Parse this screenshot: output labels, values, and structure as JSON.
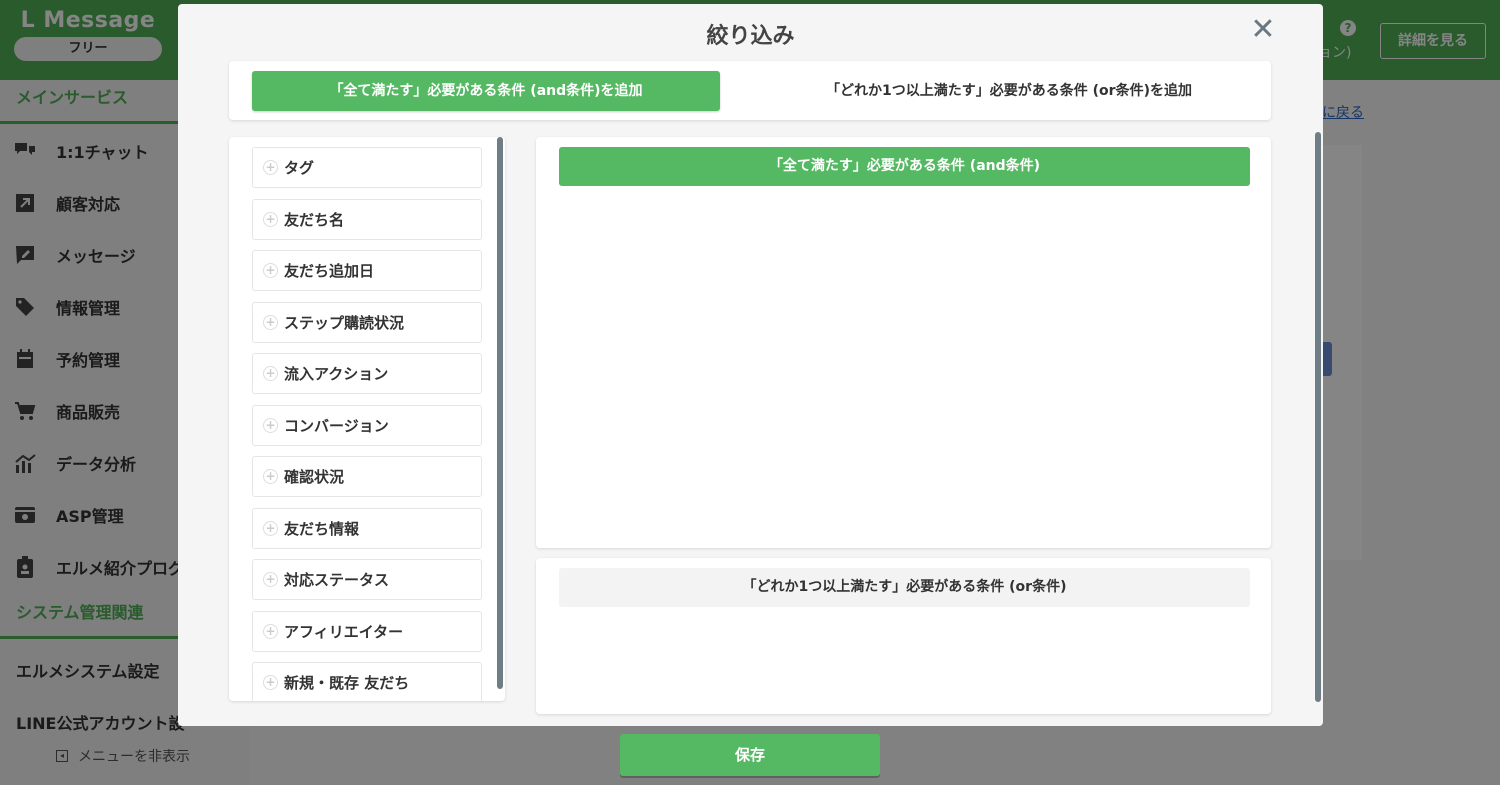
{
  "app": {
    "brand": "L Message",
    "plan": "フリー",
    "header_note": "ョン)",
    "details_label": "詳細を見る",
    "help_symbol": "?"
  },
  "sidebar": {
    "main_section": "メインサービス",
    "items": [
      {
        "label": "1:1チャット",
        "icon": "chat-icon"
      },
      {
        "label": "顧客対応",
        "icon": "arrow-icon"
      },
      {
        "label": "メッセージ",
        "icon": "edit-icon"
      },
      {
        "label": "情報管理",
        "icon": "tag-icon"
      },
      {
        "label": "予約管理",
        "icon": "calendar-icon"
      },
      {
        "label": "商品販売",
        "icon": "cart-icon"
      },
      {
        "label": "データ分析",
        "icon": "chart-icon"
      },
      {
        "label": "ASP管理",
        "icon": "card-icon"
      },
      {
        "label": "エルメ紹介プログ",
        "icon": "badge-icon"
      }
    ],
    "system_section": "システム管理関連",
    "system_items": [
      "エルメシステム設定",
      "LINE公式アカウント設"
    ],
    "hide_menu": "メニューを非表示"
  },
  "background": {
    "back_link": "に戻る"
  },
  "modal": {
    "title": "絞り込み",
    "close_symbol": "✕",
    "tabs": {
      "and_label": "「全て満たす」必要がある条件 (and条件)を追加",
      "or_label": "「どれか1つ以上満たす」必要がある条件 (or条件)を追加"
    },
    "conditions": [
      "タグ",
      "友だち名",
      "友だち追加日",
      "ステップ購読状況",
      "流入アクション",
      "コンバージョン",
      "確認状況",
      "友だち情報",
      "対応ステータス",
      "アフィリエイター",
      "新規・既存 友だち"
    ],
    "and_header": "「全て満たす」必要がある条件 (and条件)",
    "or_header": "「どれか1つ以上満たす」必要がある条件 (or条件)",
    "save_label": "保存"
  }
}
